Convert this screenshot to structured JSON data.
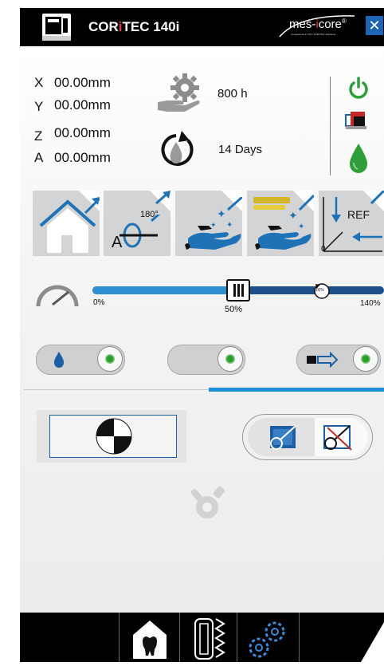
{
  "header": {
    "title_prefix": "COR",
    "title_accent": "i",
    "title_suffix": "TEC 140i",
    "brand_part1": "mes-",
    "brand_accent": "i",
    "brand_part2": "core",
    "brand_mark": "®",
    "brand_tagline": "Competence in CNC & DENTAL-Solutions",
    "close_label": "✕"
  },
  "axes": [
    {
      "label": "X",
      "value": "00.00mm"
    },
    {
      "label": "Y",
      "value": "00.00mm"
    },
    {
      "label": "Z",
      "value": "00.00mm"
    },
    {
      "label": "A",
      "value": "00.00mm"
    }
  ],
  "maintenance": {
    "hours": "800 h",
    "days": "14 Days"
  },
  "tiles": {
    "rotate_degree": "180°",
    "rotate_axis_letter": "A",
    "ref_label": "REF",
    "ref_origin": "0"
  },
  "speed": {
    "min_label": "0%",
    "current_label": "50%",
    "max_label": "140%",
    "marker_label": "100%",
    "current_fraction": 0.5
  },
  "colors": {
    "accent_blue": "#1f72b6",
    "power_green": "#2e9e3a",
    "title_accent_red": "#e53935",
    "panel_blue": "#1d5fa6"
  },
  "icons": {
    "machine": "machine-icon",
    "gear_hand": "gear-hand-icon",
    "drop_refresh": "drop-refresh-icon",
    "power": "power-icon",
    "toolbox": "toolbox-icon",
    "green_drop": "coolant-drop-icon",
    "home": "home-icon",
    "speedometer": "speedometer-icon",
    "tools_disabled": "tools-disabled-icon"
  }
}
